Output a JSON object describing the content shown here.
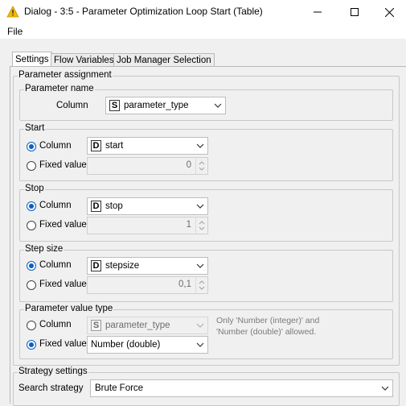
{
  "window": {
    "title": "Dialog - 3:5 - Parameter Optimization Loop Start (Table)",
    "icon": "warning-triangle-icon"
  },
  "menu": {
    "file": "File"
  },
  "tabs": [
    {
      "label": "Settings",
      "active": true
    },
    {
      "label": "Flow Variables",
      "active": false
    },
    {
      "label": "Job Manager Selection",
      "active": false
    }
  ],
  "parameter_assignment": {
    "title": "Parameter assignment",
    "parameter_name": {
      "title": "Parameter name",
      "column_label": "Column",
      "column_type_badge": "S",
      "column_value": "parameter_type"
    },
    "start": {
      "title": "Start",
      "column_label": "Column",
      "column_type_badge": "D",
      "column_value": "start",
      "fixed_label": "Fixed value",
      "fixed_value": "0",
      "selected": "column"
    },
    "stop": {
      "title": "Stop",
      "column_label": "Column",
      "column_type_badge": "D",
      "column_value": "stop",
      "fixed_label": "Fixed value",
      "fixed_value": "1",
      "selected": "column"
    },
    "step_size": {
      "title": "Step size",
      "column_label": "Column",
      "column_type_badge": "D",
      "column_value": "stepsize",
      "fixed_label": "Fixed value",
      "fixed_value": "0,1",
      "selected": "column"
    },
    "value_type": {
      "title": "Parameter value type",
      "column_label": "Column",
      "column_type_badge": "S",
      "column_value": "parameter_type",
      "fixed_label": "Fixed value",
      "fixed_value": "Number (double)",
      "selected": "fixed",
      "note_line1": "Only 'Number (integer)' and",
      "note_line2": "'Number (double)' allowed."
    }
  },
  "strategy": {
    "title": "Strategy settings",
    "search_label": "Search strategy",
    "search_value": "Brute Force"
  },
  "colors": {
    "accent": "#0b5fc1",
    "warning": "#f5b800"
  }
}
